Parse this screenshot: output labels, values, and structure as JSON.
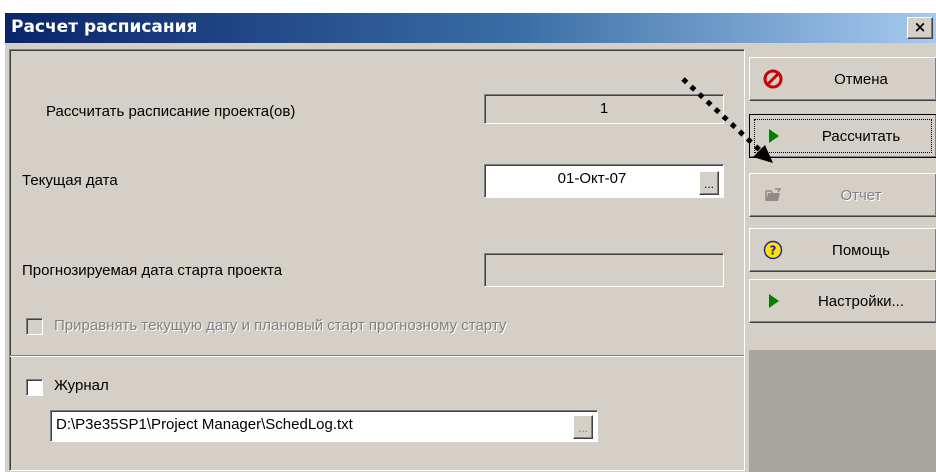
{
  "window": {
    "title": "Расчет расписания",
    "close_label": "×"
  },
  "form": {
    "projects_label": "Рассчитать расписание проекта(ов)",
    "projects_value": "1",
    "current_date_label": "Текущая дата",
    "current_date_value": "01-Окт-07",
    "forecast_label": "Прогнозируемая дата старта проекта",
    "forecast_value": "",
    "equalize_label": "Приравнять текущую дату и плановый старт прогнозному старту",
    "equalize_checked": false,
    "ellipsis_label": "..."
  },
  "log": {
    "label": "Журнал",
    "checked": false,
    "path_value": "D:\\P3e35SP1\\Project Manager\\SchedLog.txt"
  },
  "buttons": {
    "cancel": "Отмена",
    "calculate": "Рассчитать",
    "report": "Отчет",
    "help": "Помощь",
    "settings": "Настройки..."
  },
  "icons": {
    "cancel": "stop-icon",
    "calculate": "play-arrow-icon",
    "report": "report-icon",
    "help": "help-icon",
    "settings": "play-arrow-icon"
  },
  "colors": {
    "title_start": "#0a246a",
    "title_end": "#a6caf0",
    "dialog_face": "#d4d0c8",
    "cancel_red": "#cc0000",
    "play_green": "#008000",
    "help_yellow": "#ffe000"
  }
}
